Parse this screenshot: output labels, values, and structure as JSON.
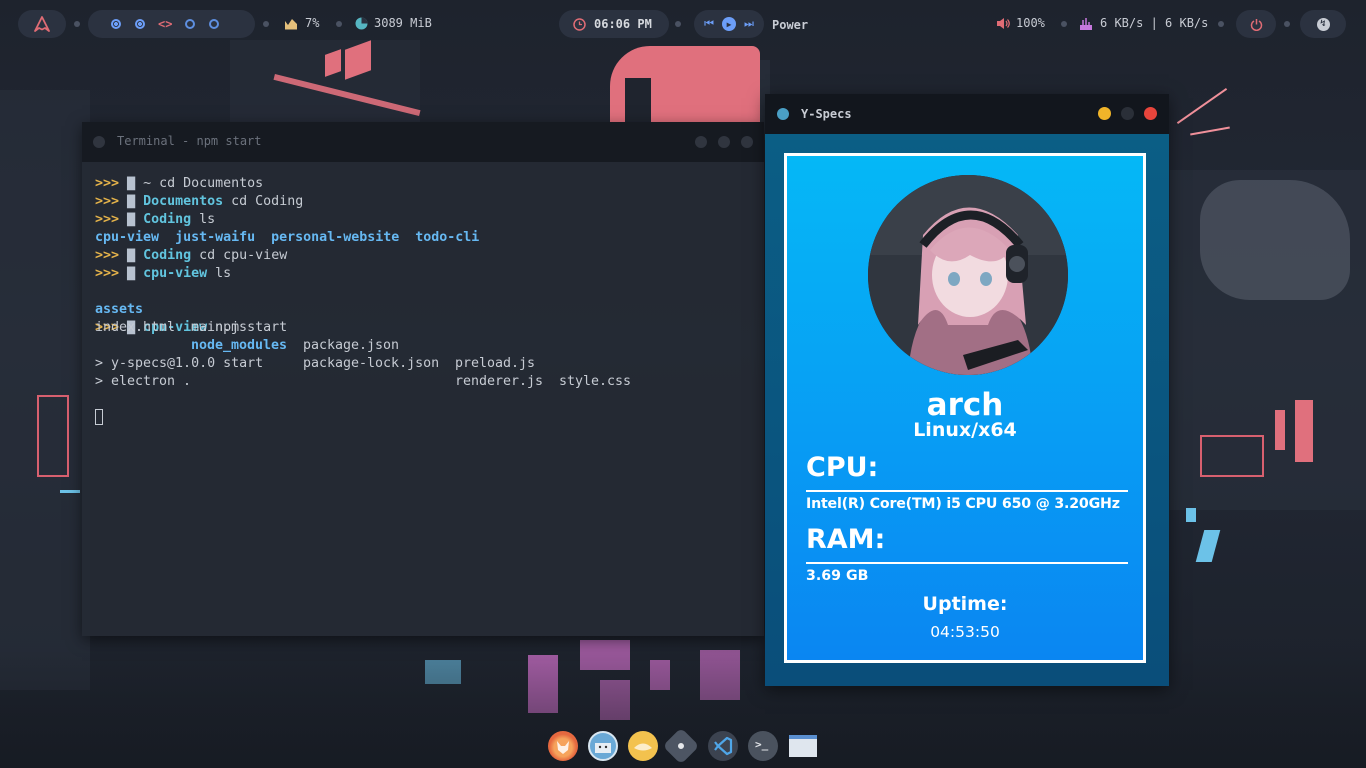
{
  "topbar": {
    "cpu": "7%",
    "memory": "3089 MiB",
    "clock": "06:06 PM",
    "media_label": "Power",
    "volume": "100%",
    "network": "6 KB/s | 6 KB/s",
    "workspace_icons": [
      "circle",
      "circle",
      "code",
      "circle",
      "circle"
    ],
    "colors": {
      "accent": "#6c9ef8",
      "power": "#e06c75",
      "arch": "#e06c75"
    }
  },
  "terminal": {
    "title": "Terminal - npm start",
    "lines": [
      {
        "dir": "~",
        "cmd": "cd Documentos"
      },
      {
        "dir": "Documentos",
        "cmd": "cd Coding"
      },
      {
        "dir": "Coding",
        "cmd": "ls"
      },
      {
        "ls_row": [
          "cpu-view",
          "just-waifu",
          "personal-website",
          "todo-cli"
        ]
      },
      {
        "dir": "Coding",
        "cmd": "cd cpu-view"
      },
      {
        "dir": "cpu-view",
        "cmd": "ls"
      },
      {
        "ls_row2a": [
          "assets",
          "main.js",
          "package.json",
          "preload.js",
          "style.css"
        ]
      },
      {
        "ls_row2b": [
          "index.html",
          "node_modules",
          "package-lock.json",
          "renderer.js"
        ]
      },
      {
        "dir": "cpu-view",
        "cmd": "npm start"
      },
      {
        "out1": "> y-specs@1.0.0 start"
      },
      {
        "out2": "> electron ."
      }
    ],
    "prompt_symbol": ">>>"
  },
  "specs": {
    "title": "Y-Specs",
    "hostname": "arch",
    "platform": "Linux/x64",
    "cpu_label": "CPU:",
    "cpu_value": "Intel(R) Core(TM) i5 CPU 650 @ 3.20GHz",
    "ram_label": "RAM:",
    "ram_value": "3.69 GB",
    "uptime_label": "Uptime:",
    "uptime_value": "04:53:50"
  },
  "dock": {
    "apps": [
      "firefox-icon",
      "finder-icon",
      "genie-icon",
      "settings-icon",
      "vscode-icon",
      "terminal-icon",
      "window-icon"
    ]
  }
}
